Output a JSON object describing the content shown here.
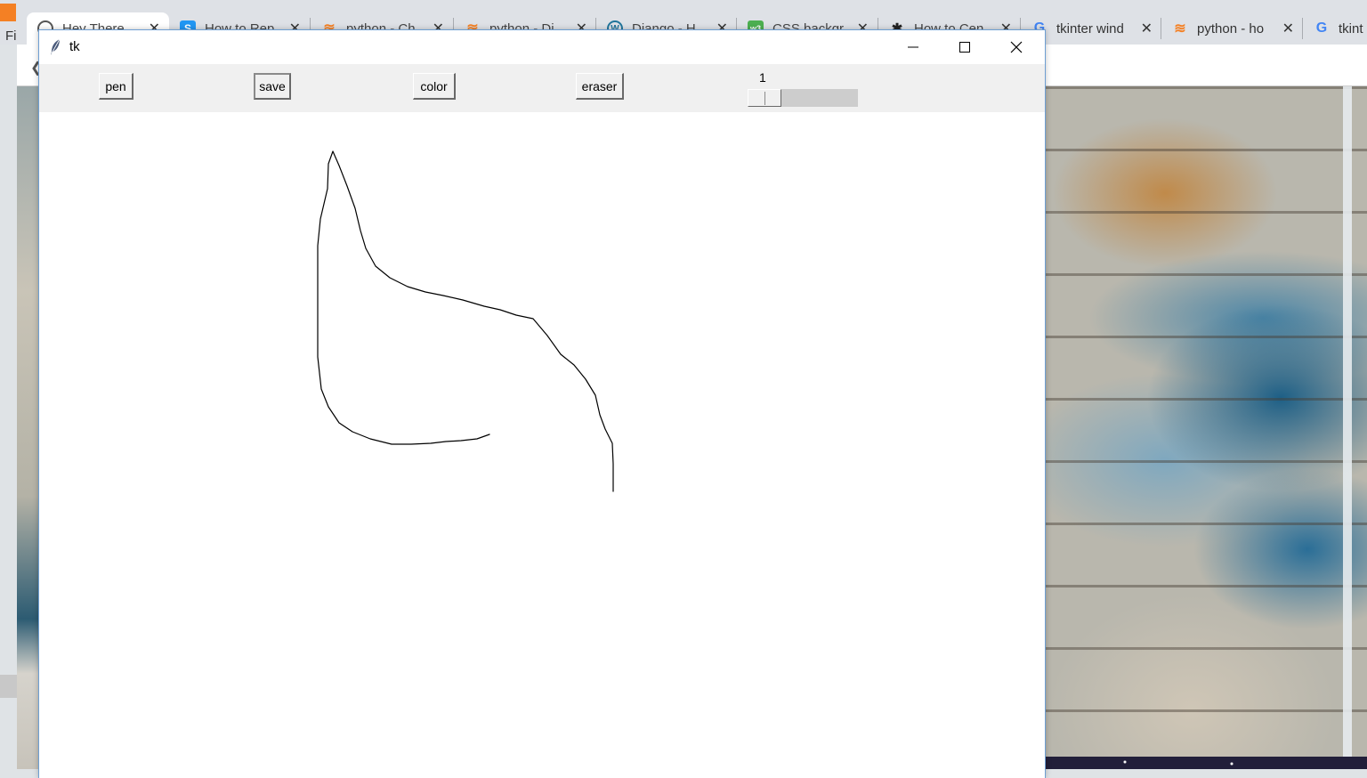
{
  "browser": {
    "menu_peek": "Fi",
    "tabs": [
      {
        "label": "Hey There",
        "favicon": "globe-icon",
        "active": true
      },
      {
        "label": "How to Rep",
        "favicon": "s-icon",
        "color": "#2196f3"
      },
      {
        "label": "python - Ch",
        "favicon": "stackoverflow-icon",
        "color": "#f48024"
      },
      {
        "label": "python - Dj",
        "favicon": "stackoverflow-icon",
        "color": "#f48024"
      },
      {
        "label": "Django - H",
        "favicon": "wordpress-icon",
        "color": "#21759b"
      },
      {
        "label": "CSS backgr",
        "favicon": "w3-icon",
        "color": "#4caf50"
      },
      {
        "label": "How to Cen",
        "favicon": "ninja-icon",
        "color": "#222222"
      },
      {
        "label": "tkinter wind",
        "favicon": "google-icon",
        "color": "#4285f4"
      },
      {
        "label": "python - ho",
        "favicon": "stackoverflow-icon",
        "color": "#f48024"
      },
      {
        "label": "tkint",
        "favicon": "google-icon",
        "color": "#4285f4"
      }
    ]
  },
  "window": {
    "title": "tk",
    "icon": "feather-icon",
    "controls": [
      "minimize-icon",
      "maximize-icon",
      "close-icon"
    ]
  },
  "toolbar": {
    "pen_label": "pen",
    "save_label": "save",
    "color_label": "color",
    "eraser_label": "eraser",
    "size_value": "1",
    "size_min": 1,
    "size_max": 10
  },
  "canvas": {
    "background": "#ffffff",
    "stroke_color": "#000000"
  }
}
